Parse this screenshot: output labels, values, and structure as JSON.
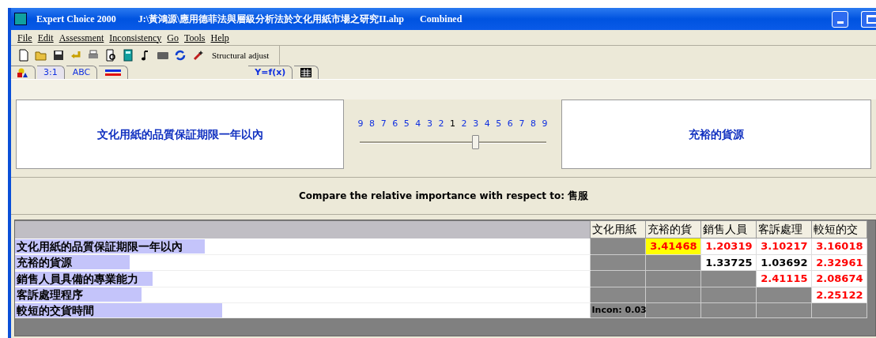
{
  "window": {
    "app": "Expert Choice 2000",
    "file": "J:\\黃鴻源\\應用德菲法與層級分析法於文化用紙市場之研究II.ahp",
    "mode": "Combined"
  },
  "menu": [
    "File",
    "Edit",
    "Assessment",
    "Inconsistency",
    "Go",
    "Tools",
    "Help"
  ],
  "toolbar": {
    "structural_adjust": "Structural adjust"
  },
  "tabs": [
    {
      "kind": "shapes",
      "selected": false
    },
    {
      "kind": "ratio",
      "label": "3:1",
      "selected": true
    },
    {
      "kind": "abc",
      "label": "ABC",
      "selected": false
    },
    {
      "kind": "bars",
      "selected": false
    },
    {
      "kind": "formula",
      "label": "Y=f(x)",
      "selected": false
    },
    {
      "kind": "grid",
      "selected": false
    }
  ],
  "comparison": {
    "left": "文化用紙的品質保証期限一年以內",
    "right": "充裕的貨源",
    "scale": [
      "9",
      "8",
      "7",
      "6",
      "5",
      "4",
      "3",
      "2",
      "1",
      "2",
      "3",
      "4",
      "5",
      "6",
      "7",
      "8",
      "9"
    ],
    "slider": {
      "level": 0.62
    },
    "prompt": "Compare the relative importance  with respect to:",
    "goal": "售服"
  },
  "matrix": {
    "columns": [
      "文化用紙",
      "充裕的貨",
      "銷售人員",
      "客訴處理",
      "較短的交"
    ],
    "rows": [
      {
        "label": "文化用紙的品質保証期限一年以內",
        "level": 0.33,
        "cells": [
          {
            "kind": "blank"
          },
          {
            "kind": "value",
            "text": "3.41468",
            "inverted": true,
            "selected": true
          },
          {
            "kind": "value",
            "text": "1.20319",
            "inverted": true,
            "selected": false
          },
          {
            "kind": "value",
            "text": "3.10217",
            "inverted": true,
            "selected": false
          },
          {
            "kind": "value",
            "text": "3.16018",
            "inverted": true,
            "selected": false
          }
        ]
      },
      {
        "label": "充裕的貨源",
        "level": 0.2,
        "cells": [
          {
            "kind": "blank"
          },
          {
            "kind": "blank"
          },
          {
            "kind": "value",
            "text": "1.33725",
            "inverted": false,
            "selected": false
          },
          {
            "kind": "value",
            "text": "1.03692",
            "inverted": false,
            "selected": false
          },
          {
            "kind": "value",
            "text": "2.32961",
            "inverted": true,
            "selected": false
          }
        ]
      },
      {
        "label": "銷售人員具備的專業能力",
        "level": 0.24,
        "cells": [
          {
            "kind": "blank"
          },
          {
            "kind": "blank"
          },
          {
            "kind": "blank"
          },
          {
            "kind": "value",
            "text": "2.41115",
            "inverted": true,
            "selected": false
          },
          {
            "kind": "value",
            "text": "2.08674",
            "inverted": true,
            "selected": false
          }
        ]
      },
      {
        "label": "客訴處理程序",
        "level": 0.22,
        "cells": [
          {
            "kind": "blank"
          },
          {
            "kind": "blank"
          },
          {
            "kind": "blank"
          },
          {
            "kind": "blank"
          },
          {
            "kind": "value",
            "text": "2.25122",
            "inverted": true,
            "selected": false
          }
        ]
      },
      {
        "label": "較短的交貨時間",
        "level": 0.36,
        "cells": [
          {
            "kind": "incon",
            "text": "Incon: 0.03"
          },
          {
            "kind": "blank"
          },
          {
            "kind": "blank"
          },
          {
            "kind": "blank"
          },
          {
            "kind": "blank"
          }
        ]
      }
    ]
  }
}
